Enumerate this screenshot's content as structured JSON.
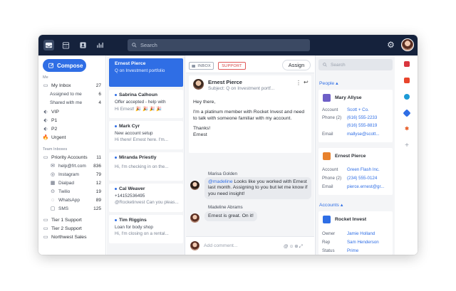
{
  "topbar": {
    "search_placeholder": "Search",
    "icons": [
      "inbox-icon",
      "calendar-icon",
      "contacts-icon",
      "analytics-icon"
    ],
    "colors": {
      "bar": "#15223c",
      "accent": "#2f6ee5"
    }
  },
  "sidebar": {
    "compose_label": "Compose",
    "me_label": "Me",
    "my_inbox": {
      "label": "My Inbox",
      "count": "27"
    },
    "assigned": {
      "label": "Assigned to me",
      "count": "6"
    },
    "shared": {
      "label": "Shared with me",
      "count": "4"
    },
    "tags": [
      "VIP",
      "P1",
      "P2",
      "Urgent"
    ],
    "team_label": "Team Inboxes",
    "priority": {
      "label": "Priority Accounts",
      "count": "11"
    },
    "channels": [
      {
        "label": "help@frt.com",
        "count": "836"
      },
      {
        "label": "Instagram",
        "count": "79"
      },
      {
        "label": "Dialpad",
        "count": "12"
      },
      {
        "label": "Twilio",
        "count": "19"
      },
      {
        "label": "WhatsApp",
        "count": "89"
      },
      {
        "label": "SMS",
        "count": "125"
      }
    ],
    "teams": [
      "Tier 1 Support",
      "Tier 2 Support",
      "Northwest Sales"
    ]
  },
  "conversations": [
    {
      "name": "Ernest Pierce",
      "subject": "Q on Investment portfolio",
      "preview": ""
    },
    {
      "name": "Sabrina Calhoun",
      "subject": "Offer accepted - help with",
      "preview": "Hi Ernest! 🎉 🎉 🎉 🎉"
    },
    {
      "name": "Mark Cyr",
      "subject": "New account setup",
      "preview": "Hi there! Ernest here. I'm..."
    },
    {
      "name": "Miranda Priestly",
      "subject": "Hi, I'm",
      "preview": "Hi, I'm checking in on the..."
    },
    {
      "name": "Cal Weaver",
      "subject": "+14152536495",
      "preview": "@Rocketinvest Can you pleas..."
    },
    {
      "name": "Tim Riggins",
      "subject": "Loan for body shop",
      "preview": "Hi, I'm closing on a rental..."
    }
  ],
  "thread": {
    "tag_inbox": "INBOX",
    "tag_support": "SUPPORT",
    "assign_label": "Assign",
    "from": "Ernest Pierce",
    "subject": "Subject: Q on Investment portf...",
    "greeting": "Hey there,",
    "body": "I'm a platinum member with Rocket Invest and need to talk with someone familiar with my account.",
    "signoff1": "Thanks!",
    "signoff2": "Ernest",
    "comments": [
      {
        "author": "Marisa Golden",
        "mention": "@madeline",
        "text": " Looks like you worked with Ernest last month. Assigning to you but let me know if you need insight!"
      },
      {
        "author": "Madeline Abrams",
        "mention": "",
        "text": "Ernest is great. On it!"
      }
    ],
    "comment_placeholder": "Add comment..."
  },
  "right": {
    "search_placeholder": "Search",
    "people_label": "People",
    "people": [
      {
        "name": "Mary Allyse",
        "account": "Scott + Co.",
        "phone": "(616) 555-2233",
        "phone2": "(616) 555-8819",
        "email": "mallyse@scott..."
      },
      {
        "name": "Ernest Pierce",
        "account": "Green Flash Inc.",
        "phone": "(234) 555-0124",
        "phone2": "",
        "email": "pierce.ernest@gr..."
      }
    ],
    "accounts_label": "Accounts",
    "account": {
      "name": "Rocket Invest",
      "owner": "Jamie Holland",
      "rep": "Sam Henderson",
      "status": "Prime"
    },
    "field_labels": {
      "account": "Account",
      "phone": "Phone (2)",
      "email": "Email",
      "owner": "Owner",
      "rep": "Rep",
      "status": "Status"
    }
  }
}
